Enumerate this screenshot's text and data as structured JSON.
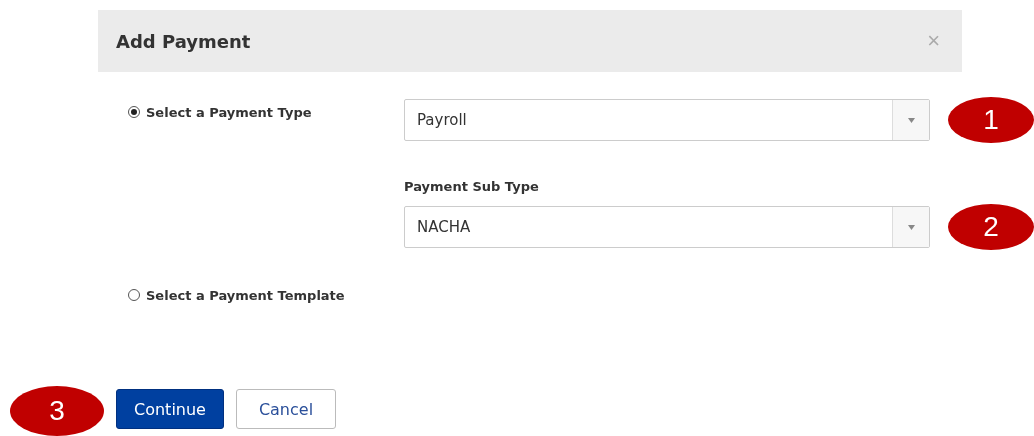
{
  "dialog": {
    "title": "Add Payment",
    "close": "×"
  },
  "options": [
    {
      "label": "Select a Payment Type",
      "selected": true,
      "fields": [
        {
          "value": "Payroll",
          "callout": "1"
        },
        {
          "label": "Payment Sub Type",
          "value": "NACHA",
          "callout": "2"
        }
      ]
    },
    {
      "label": "Select a Payment Template",
      "selected": false
    }
  ],
  "actions": {
    "callout": "3",
    "buttons": [
      {
        "label": "Continue",
        "kind": "primary"
      },
      {
        "label": "Cancel",
        "kind": "secondary"
      }
    ]
  }
}
